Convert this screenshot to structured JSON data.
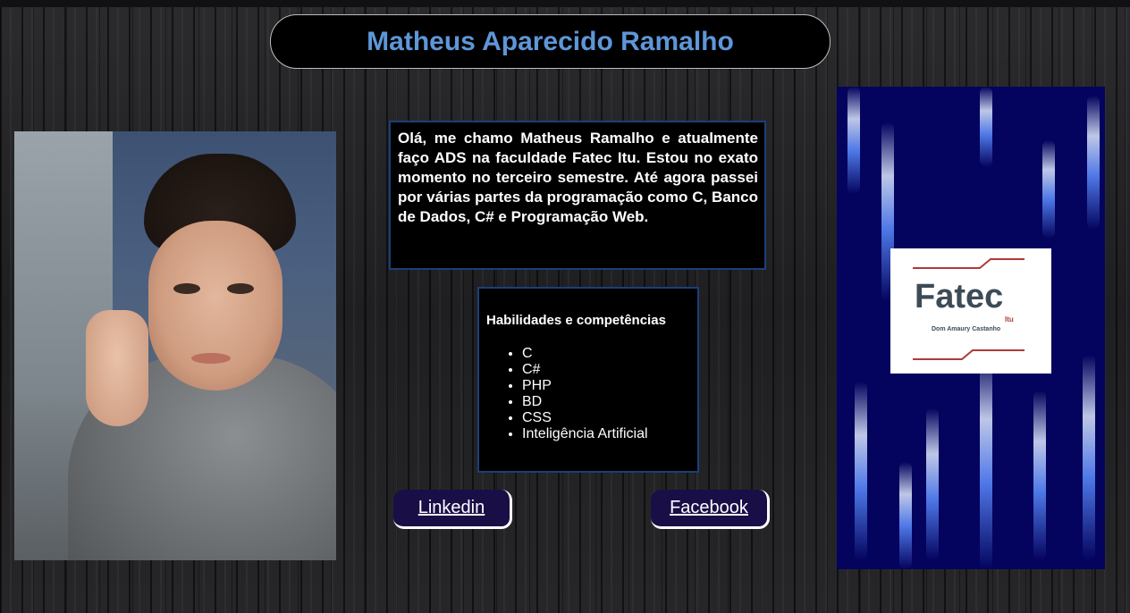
{
  "header": {
    "title": "Matheus Aparecido Ramalho"
  },
  "intro": {
    "text": "Olá, me chamo Matheus Ramalho e atualmente faço ADS na faculdade Fatec Itu. Estou no exato momento no terceiro semestre. Até agora passei por várias partes da programação como C, Banco de Dados, C# e Programação Web."
  },
  "skills": {
    "title": "Habilidades e competências",
    "items": [
      "C",
      "C#",
      "PHP",
      "BD",
      "CSS",
      "Inteligência Artificial"
    ]
  },
  "links": {
    "linkedin": "Linkedin",
    "facebook": "Facebook"
  },
  "logo": {
    "name": "Fatec",
    "city": "Itu",
    "subtitle": "Dom Amaury Castanho"
  },
  "colors": {
    "title": "#5e97d8",
    "box_border": "#1b3f7a",
    "button_bg": "#1a0e47",
    "logo_red": "#b03a3a",
    "logo_gray": "#3d4b57"
  }
}
